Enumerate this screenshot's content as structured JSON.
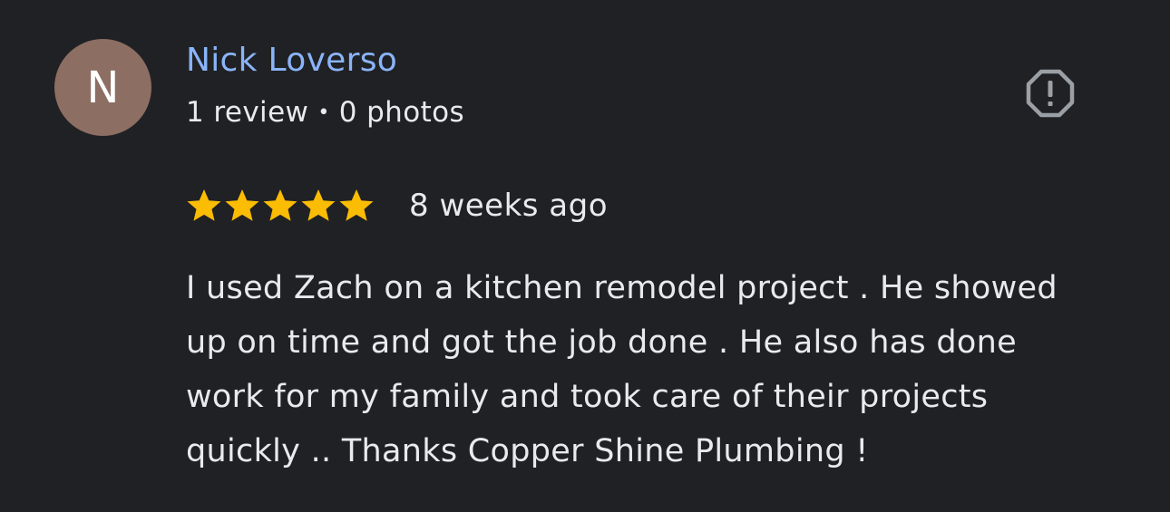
{
  "reviewer": {
    "initial": "N",
    "avatar_color": "#8d6e63",
    "name": "Nick Loverso",
    "review_count": "1 review",
    "separator": "•",
    "photo_count": "0 photos"
  },
  "report": {
    "icon": "report-octagon-icon"
  },
  "rating": {
    "stars": 5,
    "max_stars": 5,
    "star_color": "#fbbc04",
    "time_ago": "8 weeks ago"
  },
  "review": {
    "text": "I used Zach on a kitchen remodel project . He showed up on time and got the job done . He also has done work for my family and took care of their projects quickly .. Thanks Copper Shine Plumbing !"
  }
}
